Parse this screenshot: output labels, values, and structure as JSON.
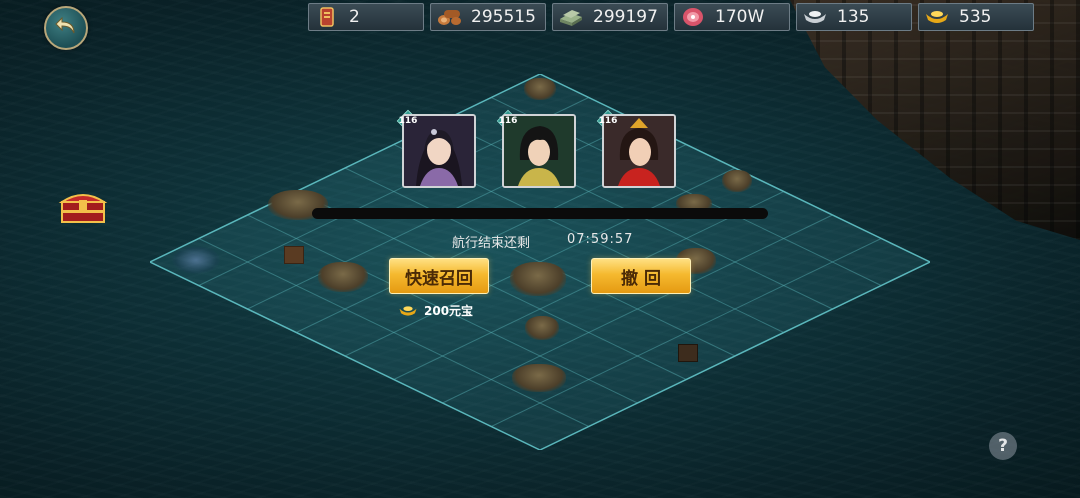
{
  "resources": [
    {
      "icon": "scroll-icon",
      "value": "2"
    },
    {
      "icon": "wood-icon",
      "value": "295515"
    },
    {
      "icon": "stone-icon",
      "value": "299197"
    },
    {
      "icon": "meat-icon",
      "value": "170W"
    },
    {
      "icon": "silver-icon",
      "value": "135"
    },
    {
      "icon": "gold-ingot-icon",
      "value": "535"
    }
  ],
  "heroes": [
    {
      "level": "116"
    },
    {
      "level": "116"
    },
    {
      "level": "116"
    }
  ],
  "voyage": {
    "timer_label": "航行结束还剩",
    "timer_value": "07:59:57"
  },
  "buttons": {
    "quick_recall": "快速召回",
    "withdraw": "撤 回"
  },
  "cost": {
    "icon": "gold-ingot-icon",
    "text": "200元宝"
  },
  "help": "?",
  "colors": {
    "accent_gold": "#f5b92f",
    "sea": "#0e3239",
    "grid_line": "#3fa0a8"
  }
}
